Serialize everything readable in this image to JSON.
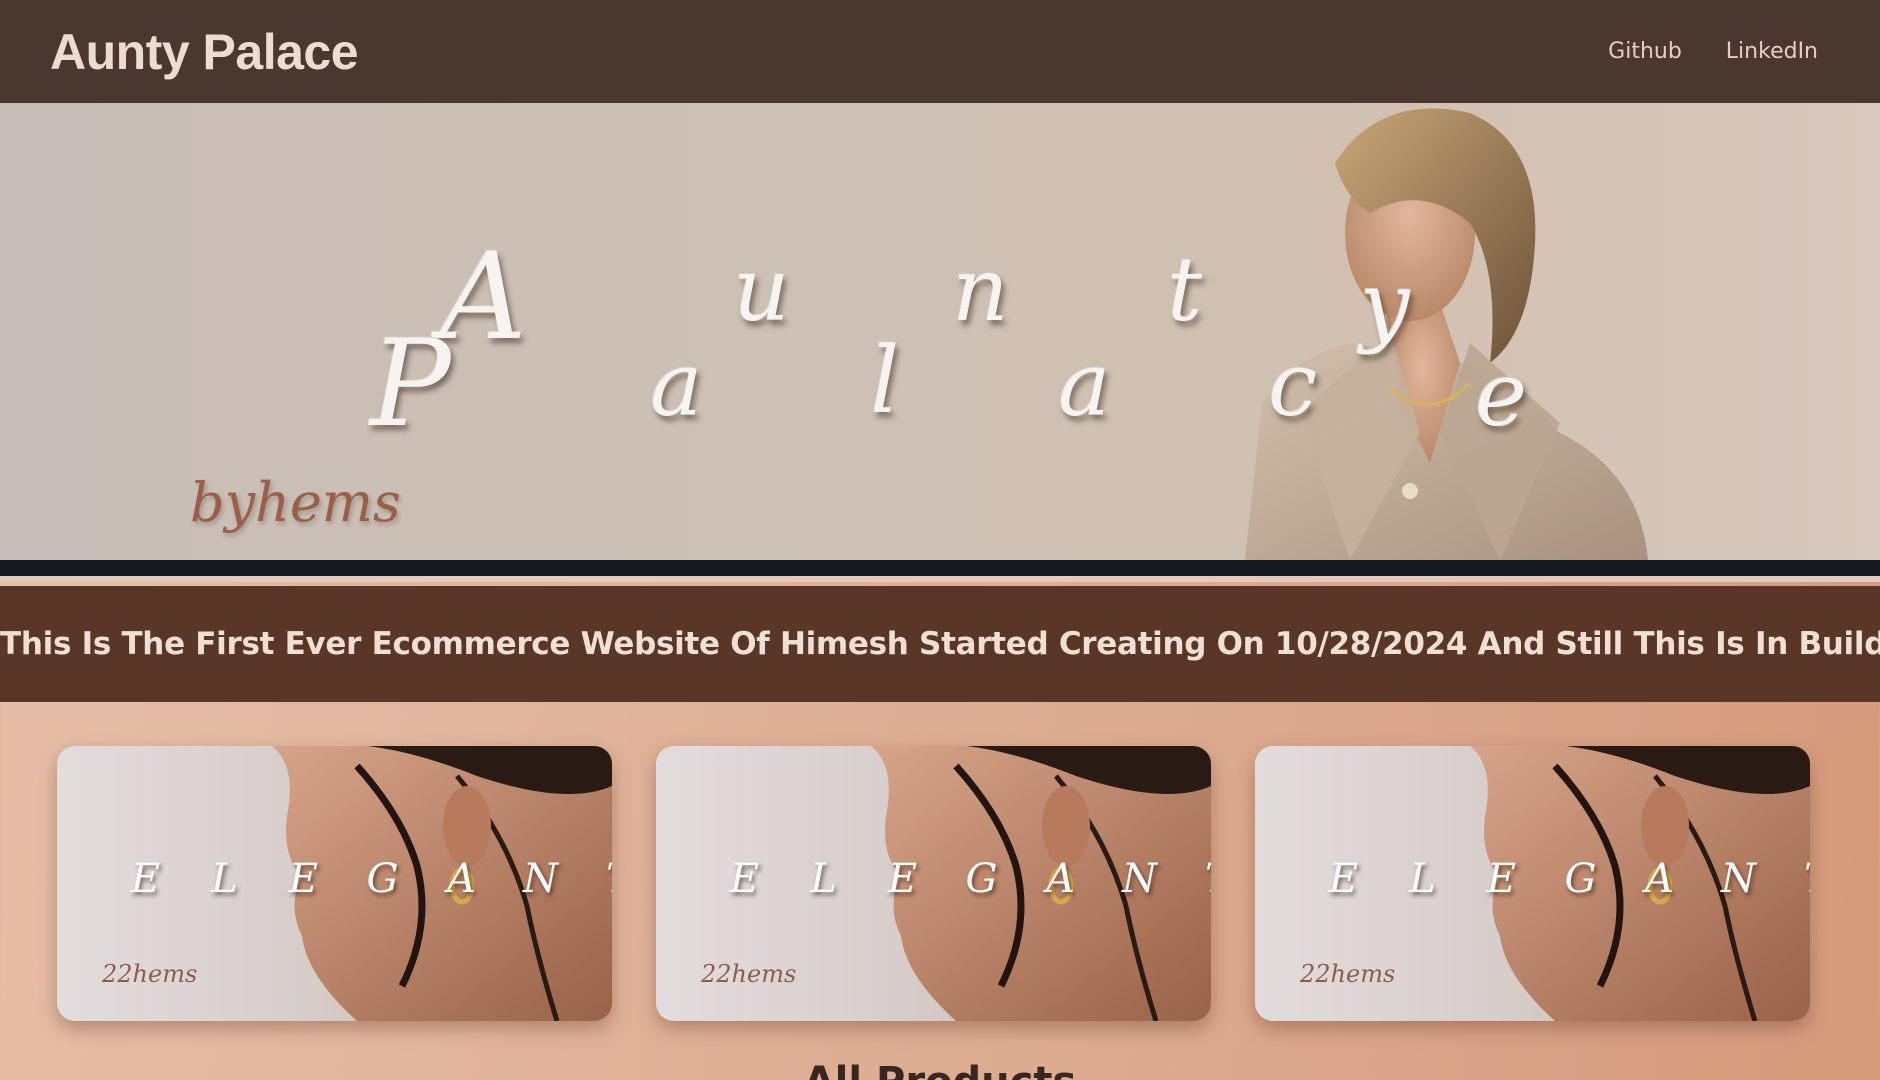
{
  "navbar": {
    "brand": "Aunty Palace",
    "links": [
      "Github",
      "LinkedIn"
    ]
  },
  "hero": {
    "line1": [
      "A",
      "u",
      "n",
      "t",
      "y"
    ],
    "line2": [
      "P",
      "a",
      "l",
      "a",
      "c",
      "e"
    ],
    "byline": "byhems"
  },
  "banner": {
    "text": "This Is The First Ever Ecommerce Website Of Himesh Started Creating On 10/28/2024 And Still This Is In Building Proce"
  },
  "cards": [
    {
      "letters": [
        "E",
        "L",
        "E",
        "G",
        "A",
        "N",
        "T"
      ],
      "signature": "22hems"
    },
    {
      "letters": [
        "E",
        "L",
        "E",
        "G",
        "A",
        "N",
        "T"
      ],
      "signature": "22hems"
    },
    {
      "letters": [
        "E",
        "L",
        "E",
        "G",
        "A",
        "N",
        "T"
      ],
      "signature": "22hems"
    }
  ],
  "section": {
    "title": "All Products"
  },
  "colors": {
    "navbar": "#4a3830",
    "banner": "#5a3628",
    "page_background": "#dcab90"
  }
}
